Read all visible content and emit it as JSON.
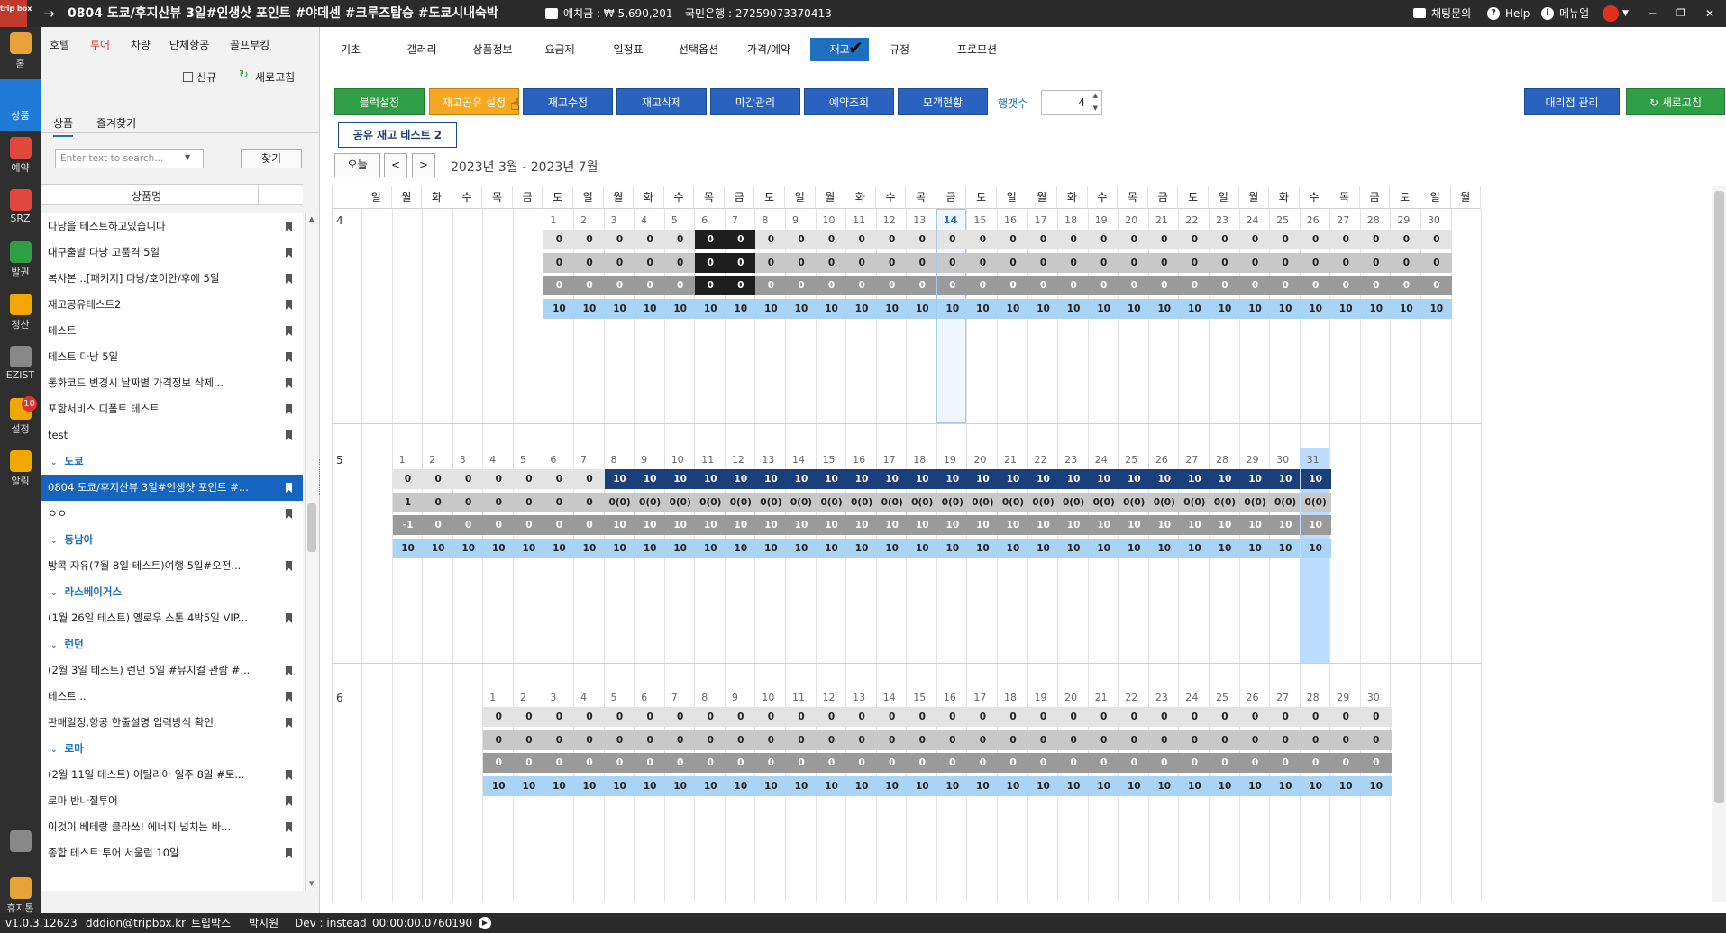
{
  "titlebar": {
    "logo": "trip box",
    "title": "0804 도쿄/후지산뷰 3일#인생샷 포인트 #야데센 #크루즈탑승 #도쿄시내숙박",
    "deposit": "예치금 : ₩ 5,690,201",
    "bank": "국민은행 : 27259073370413",
    "chat": "채팅문의",
    "help": "Help",
    "menu": "메뉴얼",
    "arrow": "→"
  },
  "rail": [
    {
      "label": "홈",
      "icon": "home-chart-icon",
      "color": "#e8a23a"
    },
    {
      "label": "상품",
      "icon": "globe-icon",
      "color": "#1f7ad8"
    },
    {
      "label": "예약",
      "icon": "cart-icon",
      "color": "#e0483d"
    },
    {
      "label": "SRZ",
      "icon": "share-icon",
      "color": "#e0483d"
    },
    {
      "label": "발권",
      "icon": "plane-icon",
      "color": "#2f9e44"
    },
    {
      "label": "정산",
      "icon": "wallet-icon",
      "color": "#f0a800"
    },
    {
      "label": "EZIST",
      "icon": "globe-grid-icon",
      "color": "#888888"
    },
    {
      "label": "설정",
      "icon": "gear-icon",
      "color": "#f0a800",
      "badge": "10"
    },
    {
      "label": "알림",
      "icon": "chat-bubble-icon",
      "color": "#f0a800"
    }
  ],
  "rail_bottom": [
    {
      "label": "",
      "icon": "apps-grid-icon"
    },
    {
      "label": "휴지통",
      "icon": "trash-icon"
    }
  ],
  "sidebar": {
    "tabs": [
      "호텔",
      "투어",
      "차량",
      "단체항공",
      "골프부킹"
    ],
    "active_tab": "투어",
    "new_label": "신규",
    "refresh_label": "새로고침",
    "subtabs": [
      "상품",
      "즐겨찾기"
    ],
    "search_placeholder": "Enter text to search...",
    "search_button": "찾기",
    "column_header": "상품명",
    "items": [
      {
        "text": "다낭을 테스트하고있습니다",
        "type": "item"
      },
      {
        "text": "대구출발 다낭 고품격 5일",
        "type": "item"
      },
      {
        "text": "복사본...[패키지] 다낭/호이안/후에 5일",
        "type": "item"
      },
      {
        "text": "재고공유테스트2",
        "type": "item"
      },
      {
        "text": "테스트",
        "type": "item"
      },
      {
        "text": "테스트 다낭 5일",
        "type": "item"
      },
      {
        "text": "통화코드 변경시 날짜별 가격정보 삭제...",
        "type": "item"
      },
      {
        "text": "포함서비스 디폴트 테스트",
        "type": "item"
      },
      {
        "text": "test",
        "type": "item"
      },
      {
        "text": "도쿄",
        "type": "group"
      },
      {
        "text": "0804 도쿄/후지산뷰 3일#인생샷 포인트 #...",
        "type": "selected"
      },
      {
        "text": "ㅇㅇ",
        "type": "item"
      },
      {
        "text": "동남아",
        "type": "group"
      },
      {
        "text": "방콕 자유(7월 8일 테스트)여행 5일#오전...",
        "type": "item"
      },
      {
        "text": "라스베이거스",
        "type": "group"
      },
      {
        "text": "(1월 26일 테스트) 옐로우 스톤 4박5일 VIP...",
        "type": "item"
      },
      {
        "text": "런던",
        "type": "group"
      },
      {
        "text": "(2월 3일 테스트) 런던 5일 #뮤지컬 관람 #...",
        "type": "item"
      },
      {
        "text": "테스트...",
        "type": "item"
      },
      {
        "text": "판매일정,항공 한줄설명 입력방식 확인",
        "type": "item"
      },
      {
        "text": "로마",
        "type": "group"
      },
      {
        "text": "(2월 11일 테스트) 이탈리아 일주 8일 #토...",
        "type": "item"
      },
      {
        "text": "로마 반나절투어",
        "type": "item"
      },
      {
        "text": "이것이 베테랑 클라쓰! 에너지 넘치는 바...",
        "type": "item"
      },
      {
        "text": "종합 테스트 투어 서울럼 10일",
        "type": "item"
      }
    ]
  },
  "main": {
    "tabs": [
      "기초",
      "갤러리",
      "상품정보",
      "요금제",
      "일정표",
      "선택옵션",
      "가격/예약",
      "재고",
      "규정",
      "프로모션"
    ],
    "active_tab": "재고",
    "buttons": {
      "block": "블럭설정",
      "share": "재고공유 설정",
      "edit": "재고수정",
      "delete": "재고삭제",
      "close": "마감관리",
      "reservation": "예약조회",
      "customers": "모객현황",
      "agency": "대리점 관리",
      "refresh": "새로고침"
    },
    "rows_label": "행갯수",
    "rows_value": "4",
    "shared_label": "공유 재고 테스트 2",
    "today_button": "오늘",
    "prev": "<",
    "next": ">",
    "range": "2023년 3월 - 2023년 7월"
  },
  "calendar": {
    "weekday_headers": [
      "일",
      "월",
      "화",
      "수",
      "목",
      "금",
      "토",
      "일",
      "월",
      "화",
      "수",
      "목",
      "금",
      "토",
      "일",
      "월",
      "화",
      "수",
      "목",
      "금",
      "토",
      "일",
      "월",
      "화",
      "수",
      "목",
      "금",
      "토",
      "일",
      "월",
      "화",
      "수",
      "목",
      "금",
      "토",
      "일",
      "월"
    ],
    "colors": {
      "light": "#e3e3e3",
      "mid": "#c8c8c8",
      "dark": "#9a9a9a",
      "black": "#1e1e1e",
      "avail": "#a9d4f5",
      "navy": "#1b3f7a",
      "today": "#1f6fc0"
    },
    "months": [
      {
        "label": "4",
        "offset": 6,
        "days": 30,
        "today": 14,
        "rows": [
          {
            "value": "0",
            "style": "light",
            "overrides": {
              "6": "black",
              "7": "black"
            }
          },
          {
            "value": "0",
            "style": "mid",
            "overrides": {
              "6": "black",
              "7": "black"
            }
          },
          {
            "value": "0",
            "style": "dark",
            "overrides": {
              "6": "black",
              "7": "black"
            }
          },
          {
            "value": "10",
            "style": "avail"
          }
        ]
      },
      {
        "label": "5",
        "offset": 1,
        "days": 31,
        "highlight": 31,
        "rows": [
          {
            "pre": {
              "value": "0",
              "style": "light",
              "until": 7
            },
            "value": "10",
            "style": "navy"
          },
          {
            "pre": {
              "value": "0",
              "style": "mid",
              "until": 7
            },
            "value": "0(0)",
            "style": "mid",
            "first": "1"
          },
          {
            "pre": {
              "value": "0",
              "style": "dark",
              "until": 7
            },
            "value": "10",
            "style": "dark",
            "first": "-1"
          },
          {
            "value": "10",
            "style": "avail"
          }
        ]
      },
      {
        "label": "6",
        "offset": 4,
        "days": 30,
        "rows": [
          {
            "value": "0",
            "style": "light"
          },
          {
            "value": "0",
            "style": "mid"
          },
          {
            "value": "0",
            "style": "dark"
          },
          {
            "value": "10",
            "style": "avail"
          }
        ]
      }
    ]
  },
  "statusbar": {
    "version": "v1.0.3.12623",
    "email": "dddion@tripbox.kr",
    "company": "트립박스",
    "user": "박지원",
    "dev": "Dev : instead",
    "timer": "00:00:00.0760190"
  }
}
